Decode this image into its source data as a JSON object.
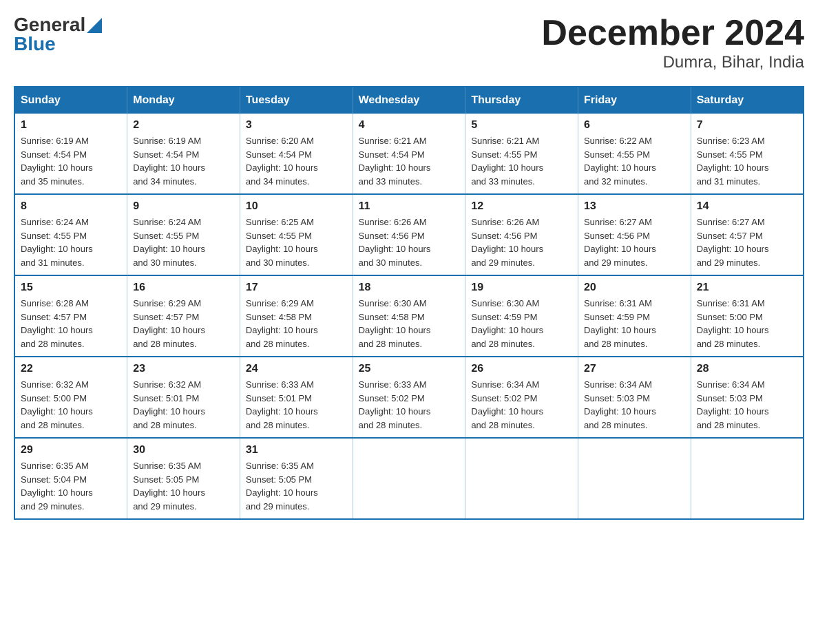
{
  "logo": {
    "general": "General",
    "arrow": "▲",
    "blue": "Blue"
  },
  "title": "December 2024",
  "subtitle": "Dumra, Bihar, India",
  "days": [
    "Sunday",
    "Monday",
    "Tuesday",
    "Wednesday",
    "Thursday",
    "Friday",
    "Saturday"
  ],
  "weeks": [
    [
      {
        "num": "1",
        "info": "Sunrise: 6:19 AM\nSunset: 4:54 PM\nDaylight: 10 hours\nand 35 minutes."
      },
      {
        "num": "2",
        "info": "Sunrise: 6:19 AM\nSunset: 4:54 PM\nDaylight: 10 hours\nand 34 minutes."
      },
      {
        "num": "3",
        "info": "Sunrise: 6:20 AM\nSunset: 4:54 PM\nDaylight: 10 hours\nand 34 minutes."
      },
      {
        "num": "4",
        "info": "Sunrise: 6:21 AM\nSunset: 4:54 PM\nDaylight: 10 hours\nand 33 minutes."
      },
      {
        "num": "5",
        "info": "Sunrise: 6:21 AM\nSunset: 4:55 PM\nDaylight: 10 hours\nand 33 minutes."
      },
      {
        "num": "6",
        "info": "Sunrise: 6:22 AM\nSunset: 4:55 PM\nDaylight: 10 hours\nand 32 minutes."
      },
      {
        "num": "7",
        "info": "Sunrise: 6:23 AM\nSunset: 4:55 PM\nDaylight: 10 hours\nand 31 minutes."
      }
    ],
    [
      {
        "num": "8",
        "info": "Sunrise: 6:24 AM\nSunset: 4:55 PM\nDaylight: 10 hours\nand 31 minutes."
      },
      {
        "num": "9",
        "info": "Sunrise: 6:24 AM\nSunset: 4:55 PM\nDaylight: 10 hours\nand 30 minutes."
      },
      {
        "num": "10",
        "info": "Sunrise: 6:25 AM\nSunset: 4:55 PM\nDaylight: 10 hours\nand 30 minutes."
      },
      {
        "num": "11",
        "info": "Sunrise: 6:26 AM\nSunset: 4:56 PM\nDaylight: 10 hours\nand 30 minutes."
      },
      {
        "num": "12",
        "info": "Sunrise: 6:26 AM\nSunset: 4:56 PM\nDaylight: 10 hours\nand 29 minutes."
      },
      {
        "num": "13",
        "info": "Sunrise: 6:27 AM\nSunset: 4:56 PM\nDaylight: 10 hours\nand 29 minutes."
      },
      {
        "num": "14",
        "info": "Sunrise: 6:27 AM\nSunset: 4:57 PM\nDaylight: 10 hours\nand 29 minutes."
      }
    ],
    [
      {
        "num": "15",
        "info": "Sunrise: 6:28 AM\nSunset: 4:57 PM\nDaylight: 10 hours\nand 28 minutes."
      },
      {
        "num": "16",
        "info": "Sunrise: 6:29 AM\nSunset: 4:57 PM\nDaylight: 10 hours\nand 28 minutes."
      },
      {
        "num": "17",
        "info": "Sunrise: 6:29 AM\nSunset: 4:58 PM\nDaylight: 10 hours\nand 28 minutes."
      },
      {
        "num": "18",
        "info": "Sunrise: 6:30 AM\nSunset: 4:58 PM\nDaylight: 10 hours\nand 28 minutes."
      },
      {
        "num": "19",
        "info": "Sunrise: 6:30 AM\nSunset: 4:59 PM\nDaylight: 10 hours\nand 28 minutes."
      },
      {
        "num": "20",
        "info": "Sunrise: 6:31 AM\nSunset: 4:59 PM\nDaylight: 10 hours\nand 28 minutes."
      },
      {
        "num": "21",
        "info": "Sunrise: 6:31 AM\nSunset: 5:00 PM\nDaylight: 10 hours\nand 28 minutes."
      }
    ],
    [
      {
        "num": "22",
        "info": "Sunrise: 6:32 AM\nSunset: 5:00 PM\nDaylight: 10 hours\nand 28 minutes."
      },
      {
        "num": "23",
        "info": "Sunrise: 6:32 AM\nSunset: 5:01 PM\nDaylight: 10 hours\nand 28 minutes."
      },
      {
        "num": "24",
        "info": "Sunrise: 6:33 AM\nSunset: 5:01 PM\nDaylight: 10 hours\nand 28 minutes."
      },
      {
        "num": "25",
        "info": "Sunrise: 6:33 AM\nSunset: 5:02 PM\nDaylight: 10 hours\nand 28 minutes."
      },
      {
        "num": "26",
        "info": "Sunrise: 6:34 AM\nSunset: 5:02 PM\nDaylight: 10 hours\nand 28 minutes."
      },
      {
        "num": "27",
        "info": "Sunrise: 6:34 AM\nSunset: 5:03 PM\nDaylight: 10 hours\nand 28 minutes."
      },
      {
        "num": "28",
        "info": "Sunrise: 6:34 AM\nSunset: 5:03 PM\nDaylight: 10 hours\nand 28 minutes."
      }
    ],
    [
      {
        "num": "29",
        "info": "Sunrise: 6:35 AM\nSunset: 5:04 PM\nDaylight: 10 hours\nand 29 minutes."
      },
      {
        "num": "30",
        "info": "Sunrise: 6:35 AM\nSunset: 5:05 PM\nDaylight: 10 hours\nand 29 minutes."
      },
      {
        "num": "31",
        "info": "Sunrise: 6:35 AM\nSunset: 5:05 PM\nDaylight: 10 hours\nand 29 minutes."
      },
      {
        "num": "",
        "info": ""
      },
      {
        "num": "",
        "info": ""
      },
      {
        "num": "",
        "info": ""
      },
      {
        "num": "",
        "info": ""
      }
    ]
  ]
}
